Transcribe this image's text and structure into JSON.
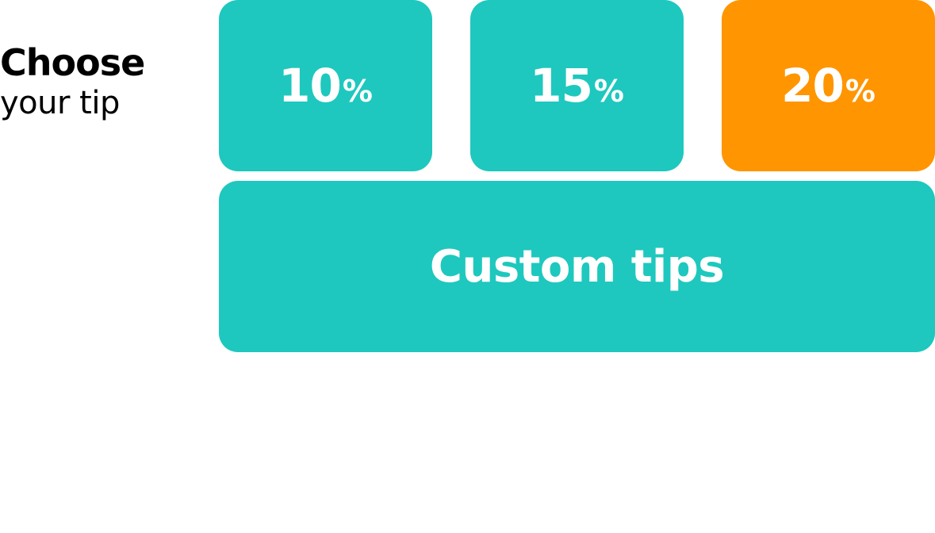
{
  "heading": {
    "title": "Choose",
    "subtitle": "your tip"
  },
  "tips": [
    {
      "value": "10",
      "unit": "%",
      "selected": false
    },
    {
      "value": "15",
      "unit": "%",
      "selected": false
    },
    {
      "value": "20",
      "unit": "%",
      "selected": true
    }
  ],
  "custom": {
    "label": "Custom tips"
  },
  "colors": {
    "accent": "#1ec8be",
    "selected": "#ff9500",
    "text_on_button": "#ffffff",
    "heading_text": "#000000"
  }
}
